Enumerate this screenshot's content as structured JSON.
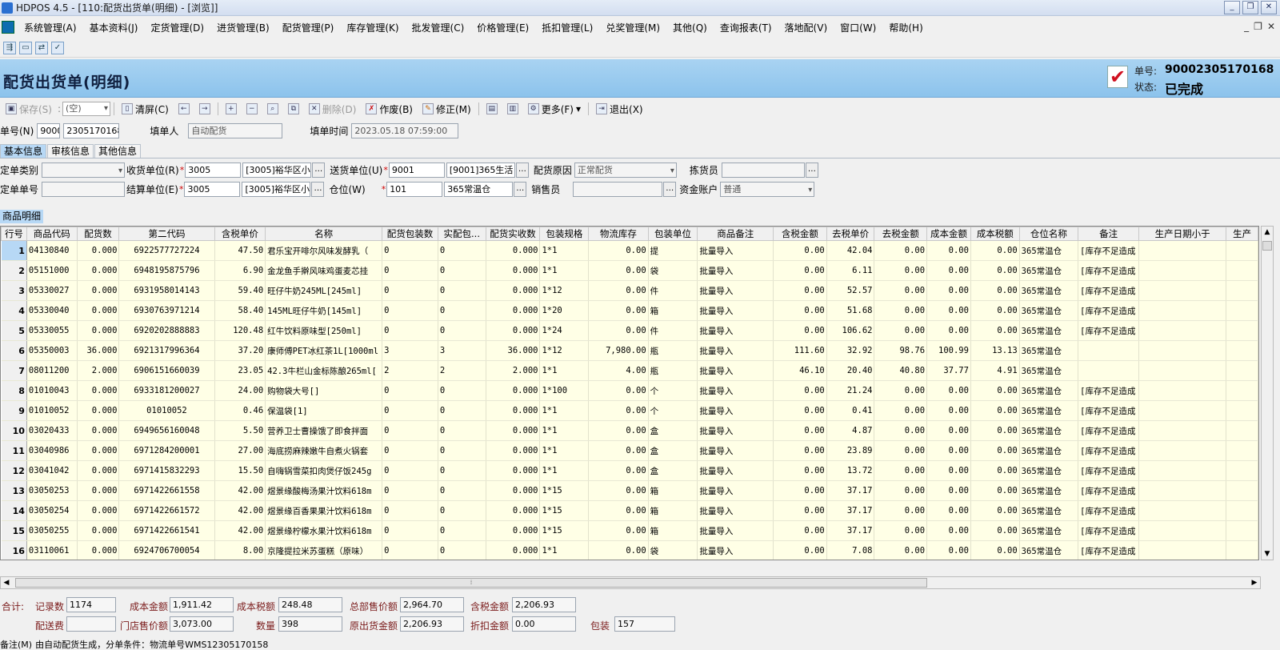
{
  "window": {
    "title": "HDPOS 4.5 - [110:配货出货单(明细) - [浏览]]",
    "controls": [
      "_",
      "❐",
      "✕"
    ]
  },
  "menu": [
    "系统管理(A)",
    "基本资料(J)",
    "定货管理(D)",
    "进货管理(B)",
    "配货管理(P)",
    "库存管理(K)",
    "批发管理(C)",
    "价格管理(E)",
    "抵扣管理(L)",
    "兑奖管理(M)",
    "其他(Q)",
    "查询报表(T)",
    "落地配(V)",
    "窗口(W)",
    "帮助(H)"
  ],
  "mdi_controls": [
    "_",
    "❐",
    "✕"
  ],
  "header": {
    "title": "配货出货单(明细)",
    "no_label": "单号:",
    "no_value": "90002305170168",
    "status_label": "状态:",
    "status_value": "已完成"
  },
  "toolbar": {
    "save": "保存(S)",
    "combo": "(空)",
    "clear": "清屏(C)",
    "delete": "删除(D)",
    "void": "作废(B)",
    "modify": "修正(M)",
    "more": "更多(F)",
    "exit": "退出(X)"
  },
  "row1": {
    "no_label": "单号(N)",
    "no_prefix": "9000",
    "no_rest": "2305170168",
    "filler_label": "填单人",
    "filler_value": "自动配货",
    "time_label": "填单时间",
    "time_value": "2023.05.18 07:59:00"
  },
  "tabs": [
    "基本信息",
    "审核信息",
    "其他信息"
  ],
  "basic": {
    "order_type_label": "定单类别",
    "order_type_value": "",
    "receiver_label": "收货单位(R)",
    "receiver_code": "3005",
    "receiver_name": "[3005]裕华区小",
    "sender_label": "送货单位(U)",
    "sender_code": "9001",
    "sender_name": "[9001]365生活",
    "reason_label": "配货原因",
    "reason_value": "正常配货",
    "picker_label": "拣货员",
    "picker_value": "",
    "order_no_label": "定单单号",
    "order_no_value": "",
    "settle_label": "结算单位(E)",
    "settle_code": "3005",
    "settle_name": "[3005]裕华区小",
    "wh_label": "仓位(W)",
    "wh_code": "101",
    "wh_name": "365常温仓",
    "sales_label": "销售员",
    "sales_value": "",
    "account_label": "资金账户",
    "account_value": "普通"
  },
  "section_title": "商品明细",
  "grid": {
    "columns": [
      "行号",
      "商品代码",
      "配货数",
      "第二代码",
      "含税单价",
      "名称",
      "配货包装数",
      "实配包...",
      "配货实收数",
      "包装规格",
      "物流库存",
      "包装单位",
      "商品备注",
      "含税金额",
      "去税单价",
      "去税金额",
      "成本金额",
      "成本税额",
      "仓位名称",
      "备注",
      "生产日期小于",
      "生产"
    ],
    "rows": [
      [
        "1",
        "04130840",
        "0.000",
        "6922577727224",
        "47.50",
        "君乐宝开啡尔风味发酵乳（",
        "0",
        "0",
        "0.000",
        "1*1",
        "0.00",
        "提",
        "批量导入",
        "0.00",
        "42.04",
        "0.00",
        "0.00",
        "0.00",
        "365常温仓",
        "[库存不足造成",
        "",
        ""
      ],
      [
        "2",
        "05151000",
        "0.000",
        "6948195875796",
        "6.90",
        "金龙鱼手擀风味鸡蛋麦芯挂",
        "0",
        "0",
        "0.000",
        "1*1",
        "0.00",
        "袋",
        "批量导入",
        "0.00",
        "6.11",
        "0.00",
        "0.00",
        "0.00",
        "365常温仓",
        "[库存不足造成",
        "",
        ""
      ],
      [
        "3",
        "05330027",
        "0.000",
        "6931958014143",
        "59.40",
        "旺仔牛奶245ML[245ml]",
        "0",
        "0",
        "0.000",
        "1*12",
        "0.00",
        "件",
        "批量导入",
        "0.00",
        "52.57",
        "0.00",
        "0.00",
        "0.00",
        "365常温仓",
        "[库存不足造成",
        "",
        ""
      ],
      [
        "4",
        "05330040",
        "0.000",
        "6930763971214",
        "58.40",
        "145ML旺仔牛奶[145ml]",
        "0",
        "0",
        "0.000",
        "1*20",
        "0.00",
        "箱",
        "批量导入",
        "0.00",
        "51.68",
        "0.00",
        "0.00",
        "0.00",
        "365常温仓",
        "[库存不足造成",
        "",
        ""
      ],
      [
        "5",
        "05330055",
        "0.000",
        "6920202888883",
        "120.48",
        "红牛饮料原味型[250ml]",
        "0",
        "0",
        "0.000",
        "1*24",
        "0.00",
        "件",
        "批量导入",
        "0.00",
        "106.62",
        "0.00",
        "0.00",
        "0.00",
        "365常温仓",
        "[库存不足造成",
        "",
        ""
      ],
      [
        "6",
        "05350003",
        "36.000",
        "6921317996364",
        "37.20",
        "康师傅PET冰红茶1L[1000ml",
        "3",
        "3",
        "36.000",
        "1*12",
        "7,980.00",
        "瓶",
        "批量导入",
        "111.60",
        "32.92",
        "98.76",
        "100.99",
        "13.13",
        "365常温仓",
        "",
        "",
        ""
      ],
      [
        "7",
        "08011200",
        "2.000",
        "6906151660039",
        "23.05",
        "42.3牛栏山金标陈酿265ml[",
        "2",
        "2",
        "2.000",
        "1*1",
        "4.00",
        "瓶",
        "批量导入",
        "46.10",
        "20.40",
        "40.80",
        "37.77",
        "4.91",
        "365常温仓",
        "",
        "",
        ""
      ],
      [
        "8",
        "01010043",
        "0.000",
        "6933181200027",
        "24.00",
        "购物袋大号[]",
        "0",
        "0",
        "0.000",
        "1*100",
        "0.00",
        "个",
        "批量导入",
        "0.00",
        "21.24",
        "0.00",
        "0.00",
        "0.00",
        "365常温仓",
        "[库存不足造成",
        "",
        ""
      ],
      [
        "9",
        "01010052",
        "0.000",
        "01010052",
        "0.46",
        "保温袋[1]",
        "0",
        "0",
        "0.000",
        "1*1",
        "0.00",
        "个",
        "批量导入",
        "0.00",
        "0.41",
        "0.00",
        "0.00",
        "0.00",
        "365常温仓",
        "[库存不足造成",
        "",
        ""
      ],
      [
        "10",
        "03020433",
        "0.000",
        "6949656160048",
        "5.50",
        "营养卫士曹操饿了即食拌面",
        "0",
        "0",
        "0.000",
        "1*1",
        "0.00",
        "盒",
        "批量导入",
        "0.00",
        "4.87",
        "0.00",
        "0.00",
        "0.00",
        "365常温仓",
        "[库存不足造成",
        "",
        ""
      ],
      [
        "11",
        "03040986",
        "0.000",
        "6971284200001",
        "27.00",
        "海底捞麻辣嫩牛自煮火锅套",
        "0",
        "0",
        "0.000",
        "1*1",
        "0.00",
        "盒",
        "批量导入",
        "0.00",
        "23.89",
        "0.00",
        "0.00",
        "0.00",
        "365常温仓",
        "[库存不足造成",
        "",
        ""
      ],
      [
        "12",
        "03041042",
        "0.000",
        "6971415832293",
        "15.50",
        "自嗨锅雪菜扣肉煲仔饭245g",
        "0",
        "0",
        "0.000",
        "1*1",
        "0.00",
        "盒",
        "批量导入",
        "0.00",
        "13.72",
        "0.00",
        "0.00",
        "0.00",
        "365常温仓",
        "[库存不足造成",
        "",
        ""
      ],
      [
        "13",
        "03050253",
        "0.000",
        "6971422661558",
        "42.00",
        "煜景缘酸梅汤果汁饮料618m",
        "0",
        "0",
        "0.000",
        "1*15",
        "0.00",
        "箱",
        "批量导入",
        "0.00",
        "37.17",
        "0.00",
        "0.00",
        "0.00",
        "365常温仓",
        "[库存不足造成",
        "",
        ""
      ],
      [
        "14",
        "03050254",
        "0.000",
        "6971422661572",
        "42.00",
        "煜景缘百香果果汁饮料618m",
        "0",
        "0",
        "0.000",
        "1*15",
        "0.00",
        "箱",
        "批量导入",
        "0.00",
        "37.17",
        "0.00",
        "0.00",
        "0.00",
        "365常温仓",
        "[库存不足造成",
        "",
        ""
      ],
      [
        "15",
        "03050255",
        "0.000",
        "6971422661541",
        "42.00",
        "煜景缘柠檬水果汁饮料618m",
        "0",
        "0",
        "0.000",
        "1*15",
        "0.00",
        "箱",
        "批量导入",
        "0.00",
        "37.17",
        "0.00",
        "0.00",
        "0.00",
        "365常温仓",
        "[库存不足造成",
        "",
        ""
      ],
      [
        "16",
        "03110061",
        "0.000",
        "6924706700054",
        "8.00",
        "京隆提拉米苏蛋糕（原味）",
        "0",
        "0",
        "0.000",
        "1*1",
        "0.00",
        "袋",
        "批量导入",
        "0.00",
        "7.08",
        "0.00",
        "0.00",
        "0.00",
        "365常温仓",
        "[库存不足造成",
        "",
        ""
      ]
    ]
  },
  "summary": {
    "total_label": "合计:",
    "records_label": "记录数",
    "records_value": "1174",
    "cost_label": "成本金额",
    "cost_value": "1,911.42",
    "cost_tax_label": "成本税额",
    "cost_tax_value": "248.48",
    "hq_price_label": "总部售价额",
    "hq_price_value": "2,964.70",
    "tax_amount_label": "含税金额",
    "tax_amount_value": "2,206.93",
    "delivery_label": "配送费",
    "delivery_value": "",
    "store_price_label": "门店售价额",
    "store_price_value": "3,073.00",
    "qty_label": "数量",
    "qty_value": "398",
    "orig_label": "原出货金额",
    "orig_value": "2,206.93",
    "discount_label": "折扣金额",
    "discount_value": "0.00",
    "pack_label": "包装",
    "pack_value": "157"
  },
  "remark": {
    "label": "备注(M)",
    "value": "由自动配货生成，分单条件：物流单号WMS12305170158"
  }
}
